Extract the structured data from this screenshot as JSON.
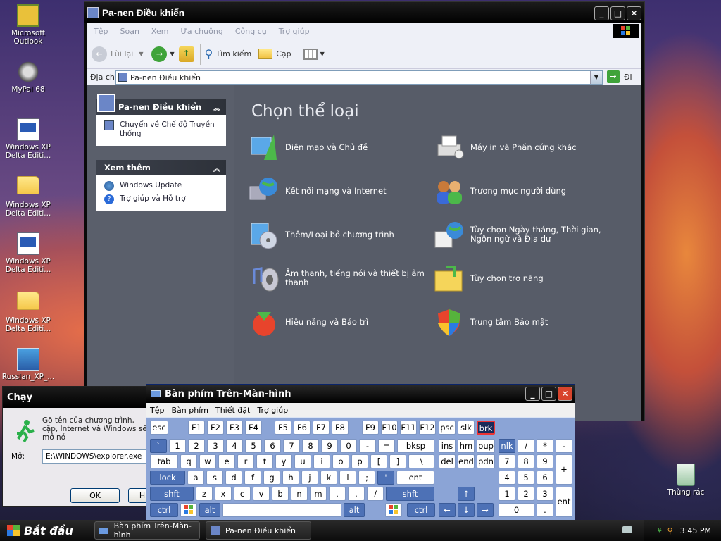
{
  "desktop": {
    "icons": [
      {
        "label": "Microsoft Outlook"
      },
      {
        "label": "MyPal 68"
      },
      {
        "label": "Windows XP Delta Editi..."
      },
      {
        "label": "Windows XP Delta Editi..."
      },
      {
        "label": "Windows XP Delta Editi..."
      },
      {
        "label": "Windows XP Delta Editi..."
      },
      {
        "label": "Russian_XP_..."
      },
      {
        "label": "Thùng rác"
      }
    ]
  },
  "control_panel": {
    "title": "Pa-nen Điều khiển",
    "menu": [
      "Tệp",
      "Soạn",
      "Xem",
      "Ưa chuộng",
      "Công cụ",
      "Trợ giúp"
    ],
    "toolbar": {
      "back": "Lùi lại",
      "search": "Tìm kiếm",
      "folders": "Cặp"
    },
    "address": {
      "label": "Địa chỉ",
      "value": "Pa-nen Điều khiển",
      "go": "Đi"
    },
    "side": {
      "panel1": {
        "title": "Pa-nen Điều khiển",
        "item": "Chuyển về Chế độ Truyền thống"
      },
      "panel2": {
        "title": "Xem thêm",
        "items": [
          "Windows Update",
          "Trợ giúp và Hỗ trợ"
        ]
      }
    },
    "heading": "Chọn thể loại",
    "categories": [
      "Diện mạo và Chủ đề",
      "Máy in và Phần cứng khác",
      "Kết nối mạng và Internet",
      "Trương mục người dùng",
      "Thêm/Loại bỏ chương trình",
      "Tùy chọn Ngày tháng, Thời gian, Ngôn ngữ và Địa dư",
      "Âm thanh, tiếng nói và thiết bị âm thanh",
      "Tùy chọn trợ năng",
      "Hiệu năng và Bảo trì",
      "Trung tâm Bảo mật"
    ]
  },
  "run_dialog": {
    "title": "Chạy",
    "text": "Gõ tên của chương trình, cặp, Internet và Windows sẽ mở nó",
    "open_label": "Mở:",
    "open_value": "E:\\WINDOWS\\explorer.exe",
    "ok": "OK",
    "cancel": "H"
  },
  "keyboard": {
    "title": "Bàn phím Trên-Màn-hình",
    "menu": [
      "Tệp",
      "Bàn phím",
      "Thiết đặt",
      "Trợ giúp"
    ],
    "keys": {
      "row0": [
        "esc",
        "F1",
        "F2",
        "F3",
        "F4",
        "F5",
        "F6",
        "F7",
        "F8",
        "F9",
        "F10",
        "F11",
        "F12",
        "psc",
        "slk",
        "brk"
      ],
      "row1": [
        "`",
        "1",
        "2",
        "3",
        "4",
        "5",
        "6",
        "7",
        "8",
        "9",
        "0",
        "-",
        "=",
        "bksp",
        "ins",
        "hm",
        "pup",
        "nlk",
        "/",
        "*",
        "-"
      ],
      "row2": [
        "tab",
        "q",
        "w",
        "e",
        "r",
        "t",
        "y",
        "u",
        "i",
        "o",
        "p",
        "[",
        "]",
        "\\",
        "del",
        "end",
        "pdn",
        "7",
        "8",
        "9",
        "+"
      ],
      "row3": [
        "lock",
        "a",
        "s",
        "d",
        "f",
        "g",
        "h",
        "j",
        "k",
        "l",
        ";",
        "'",
        "ent",
        "4",
        "5",
        "6"
      ],
      "row4": [
        "shft",
        "z",
        "x",
        "c",
        "v",
        "b",
        "n",
        "m",
        ",",
        ".",
        "/",
        "shft",
        "↑",
        "1",
        "2",
        "3",
        "ent"
      ],
      "row5": [
        "ctrl",
        "alt",
        "alt",
        "ctrl",
        "←",
        "↓",
        "→",
        "0",
        "."
      ]
    }
  },
  "taskbar": {
    "start": "Bắt đầu",
    "tasks": [
      "Bàn phím Trên-Màn-hình",
      "Pa-nen Điều khiển"
    ],
    "clock": "3:45 PM"
  }
}
